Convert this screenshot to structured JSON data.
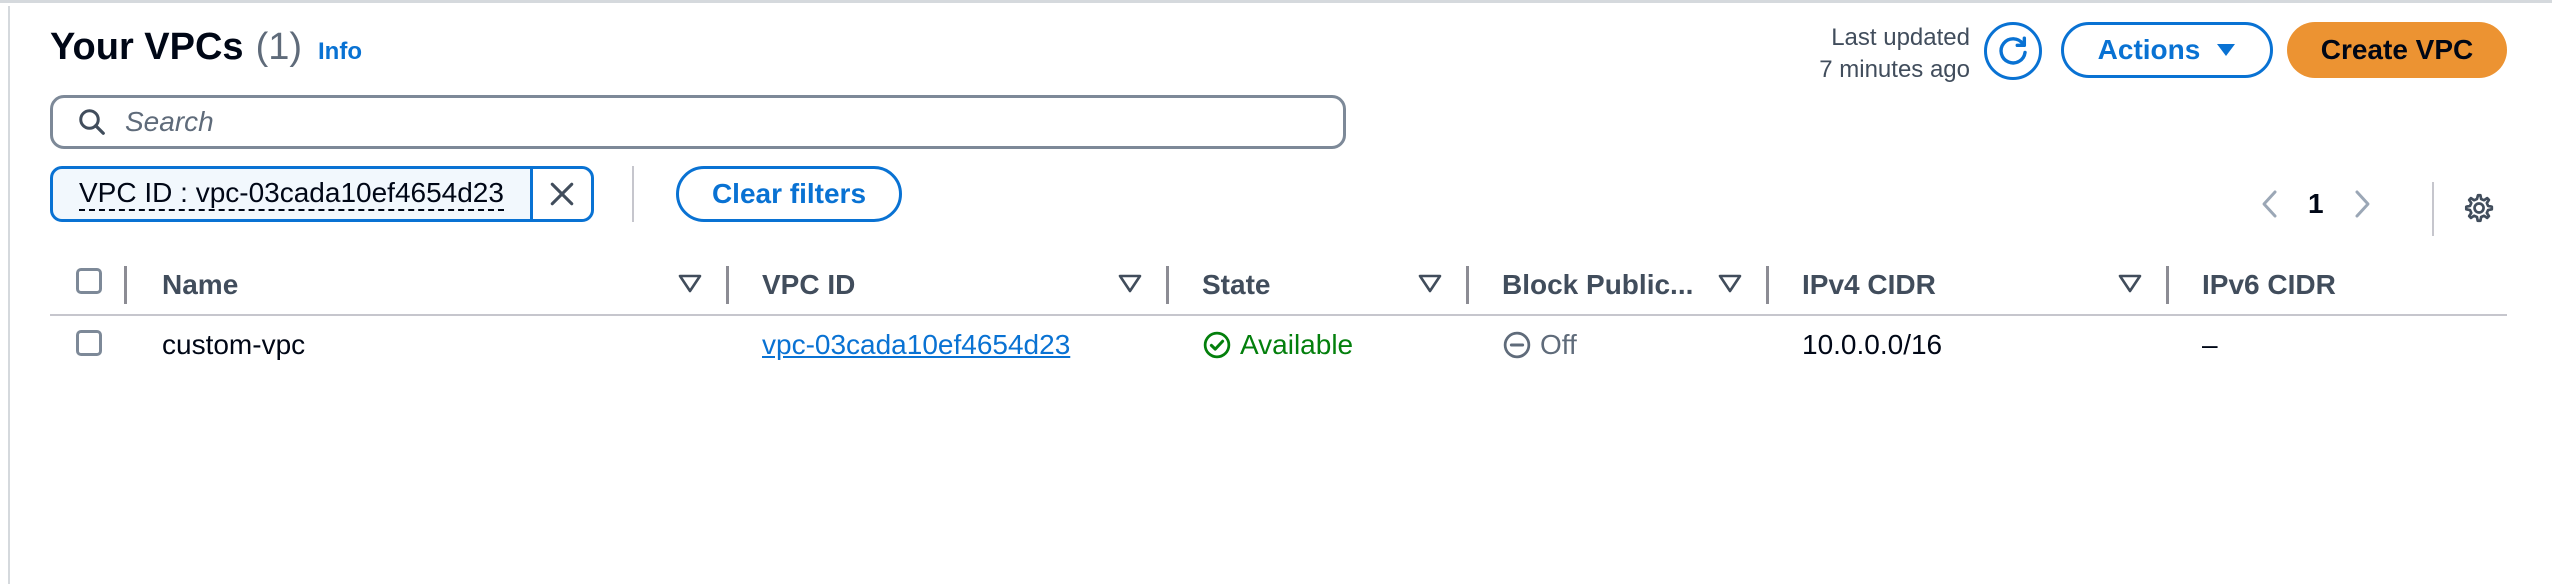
{
  "header": {
    "title": "Your VPCs",
    "count": "(1)",
    "info_label": "Info",
    "last_updated_line1": "Last updated",
    "last_updated_line2": "7 minutes ago",
    "actions_label": "Actions",
    "create_label": "Create VPC"
  },
  "search": {
    "placeholder": "Search"
  },
  "filters": {
    "token_label": "VPC ID : vpc-03cada10ef4654d23",
    "clear_label": "Clear filters"
  },
  "pagination": {
    "current_page": "1"
  },
  "table": {
    "columns": [
      "Name",
      "VPC ID",
      "State",
      "Block Public...",
      "IPv4 CIDR",
      "IPv6 CIDR"
    ],
    "rows": [
      {
        "name": "custom-vpc",
        "vpc_id": "vpc-03cada10ef4654d23",
        "state": "Available",
        "block_public": "Off",
        "ipv4_cidr": "10.0.0.0/16",
        "ipv6_cidr": "–"
      }
    ]
  },
  "colors": {
    "accent": "#0972d3",
    "primary_button": "#ec9332",
    "success": "#037f0c",
    "muted": "#5f6b7a"
  }
}
